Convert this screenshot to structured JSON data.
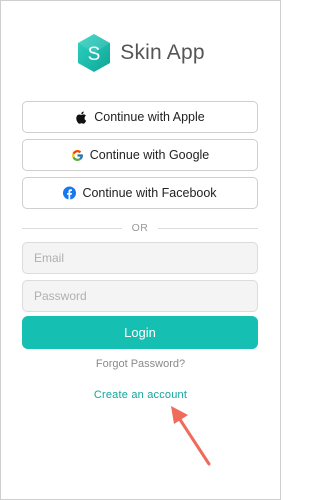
{
  "app": {
    "name": "Skin App",
    "logo_letter": "S"
  },
  "social": {
    "apple_label": "Continue with Apple",
    "google_label": "Continue with Google",
    "facebook_label": "Continue with Facebook"
  },
  "divider_text": "OR",
  "form": {
    "email_placeholder": "Email",
    "password_placeholder": "Password",
    "login_label": "Login",
    "forgot_label": "Forgot Password?",
    "create_label": "Create an account"
  },
  "colors": {
    "accent": "#15bfb1",
    "link": "#12a79c",
    "annotation_arrow": "#ef6b5b"
  }
}
